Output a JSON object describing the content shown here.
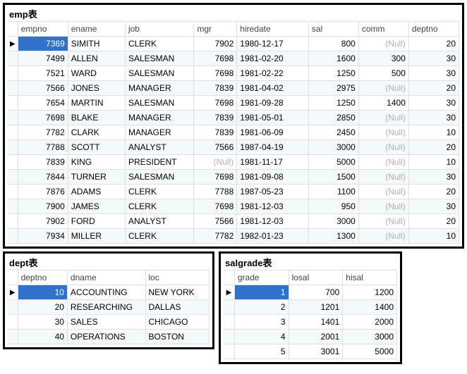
{
  "emp": {
    "title": "emp表",
    "headers": [
      "empno",
      "ename",
      "job",
      "mgr",
      "hiredate",
      "sal",
      "comm",
      "deptno"
    ],
    "rows": [
      {
        "empno": 7369,
        "ename": "SIMITH",
        "job": "CLERK",
        "mgr": 7902,
        "hiredate": "1980-12-17",
        "sal": 800,
        "comm": null,
        "deptno": 20
      },
      {
        "empno": 7499,
        "ename": "ALLEN",
        "job": "SALESMAN",
        "mgr": 7698,
        "hiredate": "1981-02-20",
        "sal": 1600,
        "comm": 300,
        "deptno": 30
      },
      {
        "empno": 7521,
        "ename": "WARD",
        "job": "SALESMAN",
        "mgr": 7698,
        "hiredate": "1981-02-22",
        "sal": 1250,
        "comm": 500,
        "deptno": 30
      },
      {
        "empno": 7566,
        "ename": "JONES",
        "job": "MANAGER",
        "mgr": 7839,
        "hiredate": "1981-04-02",
        "sal": 2975,
        "comm": null,
        "deptno": 20
      },
      {
        "empno": 7654,
        "ename": "MARTIN",
        "job": "SALESMAN",
        "mgr": 7698,
        "hiredate": "1981-09-28",
        "sal": 1250,
        "comm": 1400,
        "deptno": 30
      },
      {
        "empno": 7698,
        "ename": "BLAKE",
        "job": "MANAGER",
        "mgr": 7839,
        "hiredate": "1981-05-01",
        "sal": 2850,
        "comm": null,
        "deptno": 30
      },
      {
        "empno": 7782,
        "ename": "CLARK",
        "job": "MANAGER",
        "mgr": 7839,
        "hiredate": "1981-06-09",
        "sal": 2450,
        "comm": null,
        "deptno": 10
      },
      {
        "empno": 7788,
        "ename": "SCOTT",
        "job": "ANALYST",
        "mgr": 7566,
        "hiredate": "1987-04-19",
        "sal": 3000,
        "comm": null,
        "deptno": 20
      },
      {
        "empno": 7839,
        "ename": "KING",
        "job": "PRESIDENT",
        "mgr": null,
        "hiredate": "1981-11-17",
        "sal": 5000,
        "comm": null,
        "deptno": 10
      },
      {
        "empno": 7844,
        "ename": "TURNER",
        "job": "SALESMAN",
        "mgr": 7698,
        "hiredate": "1981-09-08",
        "sal": 1500,
        "comm": null,
        "deptno": 30
      },
      {
        "empno": 7876,
        "ename": "ADAMS",
        "job": "CLERK",
        "mgr": 7788,
        "hiredate": "1987-05-23",
        "sal": 1100,
        "comm": null,
        "deptno": 20
      },
      {
        "empno": 7900,
        "ename": "JAMES",
        "job": "CLERK",
        "mgr": 7698,
        "hiredate": "1981-12-03",
        "sal": 950,
        "comm": null,
        "deptno": 30
      },
      {
        "empno": 7902,
        "ename": "FORD",
        "job": "ANALYST",
        "mgr": 7566,
        "hiredate": "1981-12-03",
        "sal": 3000,
        "comm": null,
        "deptno": 20
      },
      {
        "empno": 7934,
        "ename": "MILLER",
        "job": "CLERK",
        "mgr": 7782,
        "hiredate": "1982-01-23",
        "sal": 1300,
        "comm": null,
        "deptno": 10
      }
    ]
  },
  "dept": {
    "title": "dept表",
    "headers": [
      "deptno",
      "dname",
      "loc"
    ],
    "rows": [
      {
        "deptno": 10,
        "dname": "ACCOUNTING",
        "loc": "NEW YORK"
      },
      {
        "deptno": 20,
        "dname": "RESEARCHING",
        "loc": "DALLAS"
      },
      {
        "deptno": 30,
        "dname": "SALES",
        "loc": "CHICAGO"
      },
      {
        "deptno": 40,
        "dname": "OPERATIONS",
        "loc": "BOSTON"
      }
    ]
  },
  "salgrade": {
    "title": "salgrade表",
    "headers": [
      "grade",
      "losal",
      "hisal"
    ],
    "rows": [
      {
        "grade": 1,
        "losal": 700,
        "hisal": 1200
      },
      {
        "grade": 2,
        "losal": 1201,
        "hisal": 1400
      },
      {
        "grade": 3,
        "losal": 1401,
        "hisal": 2000
      },
      {
        "grade": 4,
        "losal": 2001,
        "hisal": 3000
      },
      {
        "grade": 5,
        "losal": 3001,
        "hisal": 5000
      }
    ]
  },
  "nullText": "(Null)",
  "colors": {
    "selected": "#2f72c9",
    "nullText": "#b0b0b0",
    "altRow": "#f4f9fc"
  }
}
